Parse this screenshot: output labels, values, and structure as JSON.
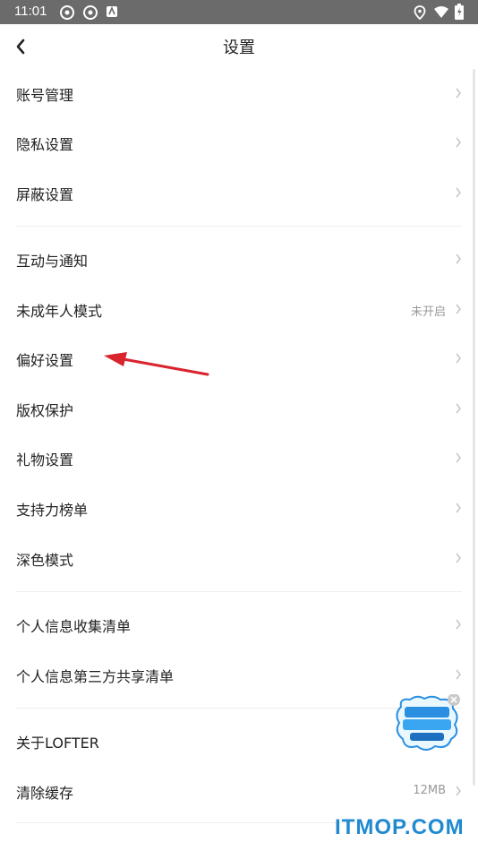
{
  "status_bar": {
    "time": "11:01"
  },
  "header": {
    "title": "设置"
  },
  "groups": [
    {
      "items": [
        {
          "label": "账号管理"
        },
        {
          "label": "隐私设置"
        },
        {
          "label": "屏蔽设置"
        }
      ]
    },
    {
      "items": [
        {
          "label": "互动与通知"
        },
        {
          "label": "未成年人模式",
          "value": "未开启"
        },
        {
          "label": "偏好设置"
        },
        {
          "label": "版权保护"
        },
        {
          "label": "礼物设置"
        },
        {
          "label": "支持力榜单"
        },
        {
          "label": "深色模式"
        }
      ]
    },
    {
      "items": [
        {
          "label": "个人信息收集清单"
        },
        {
          "label": "个人信息第三方共享清单"
        }
      ]
    },
    {
      "items": [
        {
          "label": "关于LOFTER"
        },
        {
          "label": "清除缓存",
          "value": "12MB"
        }
      ]
    }
  ],
  "watermark": "ITMOP.COM",
  "annotation_color": "#d9232d"
}
